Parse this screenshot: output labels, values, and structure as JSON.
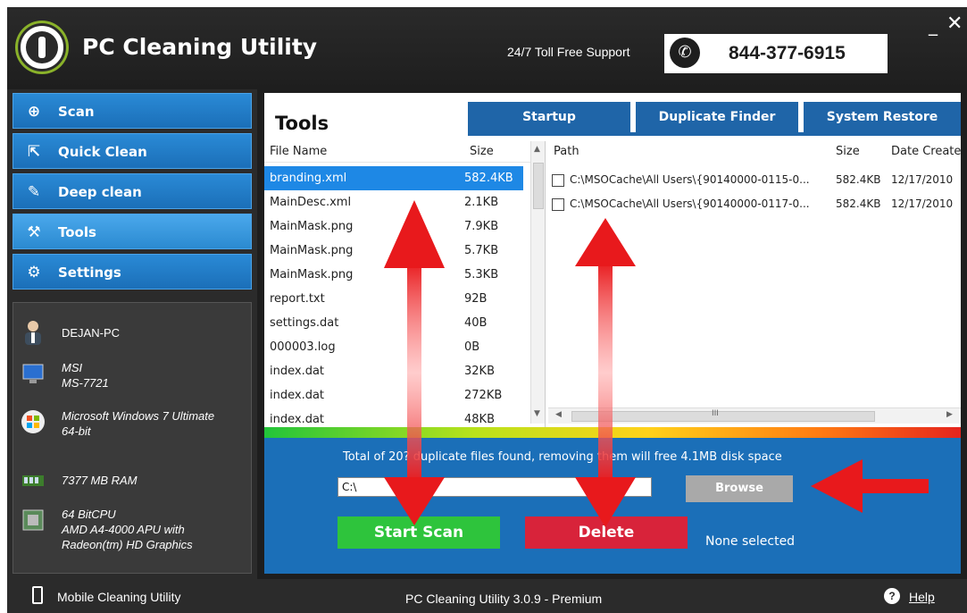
{
  "app": {
    "title": "PC Cleaning Utility",
    "support_label": "24/7 Toll Free Support",
    "phone": "844-377-6915",
    "minimize": "_",
    "close": "✕"
  },
  "sidebar": {
    "items": [
      {
        "label": "Scan",
        "icon": "magnifier-icon"
      },
      {
        "label": "Quick Clean",
        "icon": "export-icon"
      },
      {
        "label": "Deep clean",
        "icon": "brush-icon"
      },
      {
        "label": "Tools",
        "icon": "wrench-icon"
      },
      {
        "label": "Settings",
        "icon": "gear-icon"
      }
    ],
    "active": "Tools",
    "system": {
      "user": "DEJAN-PC",
      "board_vendor": "MSI",
      "board_model": "MS-7721",
      "os_line1": "Microsoft Windows 7 Ultimate",
      "os_line2": "64-bit",
      "ram": "7377 MB RAM",
      "cpu_line1": "64 BitCPU",
      "cpu_line2": "AMD A4-4000 APU with",
      "cpu_line3": "Radeon(tm) HD Graphics"
    }
  },
  "tools": {
    "title": "Tools",
    "tabs": [
      "Startup",
      "Duplicate Finder",
      "System Restore"
    ],
    "left_headers": {
      "name": "File Name",
      "size": "Size"
    },
    "files": [
      {
        "name": "branding.xml",
        "size": "582.4KB",
        "selected": true
      },
      {
        "name": "MainDesc.xml",
        "size": "2.1KB"
      },
      {
        "name": "MainMask.png",
        "size": "7.9KB"
      },
      {
        "name": "MainMask.png",
        "size": "5.7KB"
      },
      {
        "name": "MainMask.png",
        "size": "5.3KB"
      },
      {
        "name": "report.txt",
        "size": "92B"
      },
      {
        "name": "settings.dat",
        "size": "40B"
      },
      {
        "name": "000003.log",
        "size": "0B"
      },
      {
        "name": "index.dat",
        "size": "32KB"
      },
      {
        "name": "index.dat",
        "size": "272KB"
      },
      {
        "name": "index.dat",
        "size": "48KB"
      }
    ],
    "right_headers": {
      "path": "Path",
      "size": "Size",
      "date": "Date Create"
    },
    "paths": [
      {
        "path": "C:\\MSOCache\\All Users\\{90140000-0115-0...",
        "size": "582.4KB",
        "date": "12/17/2010"
      },
      {
        "path": "C:\\MSOCache\\All Users\\{90140000-0117-0...",
        "size": "582.4KB",
        "date": "12/17/2010"
      }
    ],
    "scroll_glyph": "III",
    "total_text": "Total of 20? duplicate files found, removing them will free 4.1MB disk space",
    "path_value": "C:\\",
    "browse_label": "Browse",
    "start_label": "Start Scan",
    "delete_label": "Delete",
    "selection_status": "None selected"
  },
  "footer": {
    "mobile_label": "Mobile Cleaning Utility",
    "version": "PC Cleaning Utility 3.0.9 - Premium",
    "help": "Help"
  },
  "colors": {
    "accent_blue": "#1b6fb8",
    "start_green": "#2ec43c",
    "delete_red": "#d8233a",
    "arrow_red": "#e8191c"
  }
}
